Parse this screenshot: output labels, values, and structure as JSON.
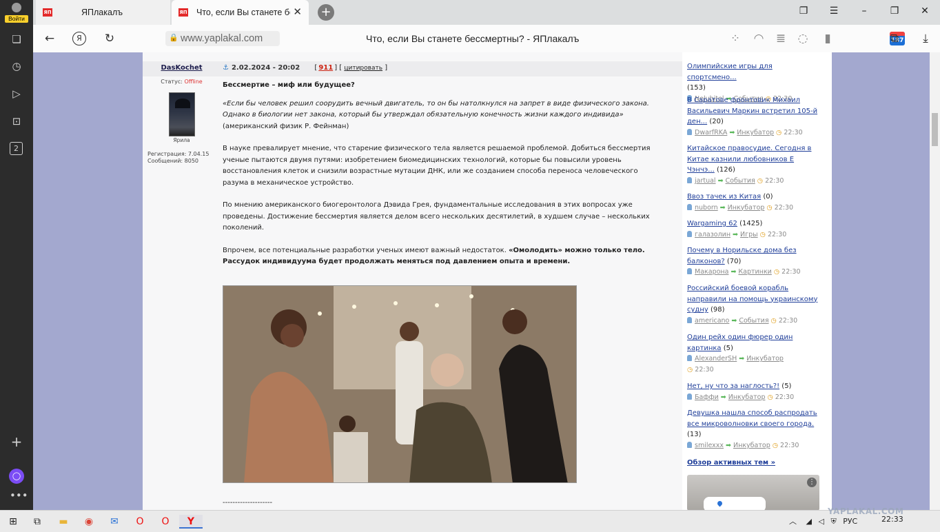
{
  "browser": {
    "login_label": "Войти",
    "tabs": [
      {
        "title": "ЯПлакалъ",
        "favicon": "ЯП"
      },
      {
        "title": "Что, если Вы станете бессмертны? - ЯПлакалъ",
        "favicon": "ЯП"
      }
    ],
    "address": "www.yaplakal.com",
    "page_title": "Что, если Вы станете бессмертны? - ЯПлакалъ",
    "badge_count": "187",
    "rail_badge": "2"
  },
  "post": {
    "author": "DasKochet",
    "status_label": "Статус:",
    "status_value": "Offline",
    "avatar_caption": "Ярила",
    "registration": "Регистрация: 7.04.15",
    "messages": "Сообщений: 8050",
    "date": "2.02.2024 - 20:02",
    "rating": "911",
    "quote_label": "цитировать",
    "heading": "Бессмертие – миф или будущее?",
    "quote": "«Если бы человек решил соорудить вечный двигатель, то он бы натолкнулся на запрет в виде физического закона. Однако в биологии нет закона, который бы утверждал обязательную конечность жизни каждого индивида»",
    "quote_source": "(американский физик Р. Фейнман)",
    "p1": "В науке превалирует мнение, что старение физического тела является решаемой проблемой. Добиться бессмертия ученые пытаются двумя путями: изобретением биомедицинских технологий, которые бы повысили уровень восстановления клеток и снизили возрастные мутации ДНК, или же созданием способа переноса человеческого разума в механическое устройство.",
    "p2": "По мнению американского биогеронтолога Дэвида Грея, фундаментальные исследования в этих вопросах уже проведены. Достижение бессмертия является делом всего нескольких десятилетий, в худшем случае – нескольких поколений.",
    "p3_plain": "Впрочем, все потенциальные разработки ученых имеют важный недостаток. ",
    "p3_bold": "«Омолодить» можно только тело. Рассудок индивидуума будет продолжать меняться под давлением опыта и времени.",
    "separator": "--------------------"
  },
  "sidebar": {
    "items": [
      {
        "title": "Олимпийские игры для спортсмено...",
        "count": "(153)",
        "user": "Nelubitel",
        "cat": "События",
        "time": "22:30"
      },
      {
        "title": "В Саратове фронтовик Михаил Васильевич Маркин встретил 105-й ден...",
        "count": "(20)",
        "user": "DwarfRKA",
        "cat": "Инкубатор",
        "time": "22:30"
      },
      {
        "title": "Китайское правосудие. Сегодня в Китае казнили любовников Е Чэнчэ...",
        "count": "(126)",
        "user": "jartual",
        "cat": "События",
        "time": "22:30"
      },
      {
        "title": "Ввоз тачек из Китая",
        "count": "(0)",
        "user": "nuborn",
        "cat": "Инкубатор",
        "time": "22:30"
      },
      {
        "title": "Wargaming 62",
        "count": "(1425)",
        "user": "галазолин",
        "cat": "Игры",
        "time": "22:30"
      },
      {
        "title": "Почему в Норильске дома без балконов?",
        "count": "(70)",
        "user": "Макарона",
        "cat": "Картинки",
        "time": "22:30"
      },
      {
        "title": "Российский боевой корабль направили на помощь украинскому судну",
        "count": "(98)",
        "user": "americano",
        "cat": "События",
        "time": "22:30"
      },
      {
        "title": "Один рейх один фюрер один картинка",
        "count": "(5)",
        "user": "AlexanderSH",
        "cat": "Инкубатор",
        "time": "22:30"
      },
      {
        "title": "Нет, ну что за наглость?!",
        "count": "(5)",
        "user": "Баффи",
        "cat": "Инкубатор",
        "time": "22:30"
      },
      {
        "title": "Девушка нашла способ распродать все микроволновки своего города.",
        "count": "(13)",
        "user": "smilexxx",
        "cat": "Инкубатор",
        "time": "22:30"
      }
    ],
    "overview": "Обзор активных тем »"
  },
  "taskbar": {
    "lang": "РУС",
    "time": "22:33"
  },
  "watermark": "YAPLAKAL.COM",
  "colors": {
    "accent_red": "#e32a2a",
    "link_blue": "#1f3e99",
    "page_bg": "#a3a8cf"
  }
}
